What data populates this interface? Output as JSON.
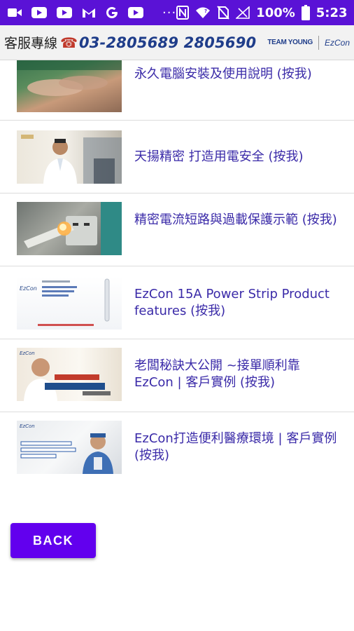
{
  "status_bar": {
    "battery": "100%",
    "time": "5:23",
    "dots": "···",
    "icons": [
      "video-camera-icon",
      "youtube-icon",
      "youtube-icon",
      "gmail-icon",
      "google-icon",
      "youtube-icon",
      "nfc-icon",
      "wifi-icon",
      "no-sim-icon",
      "signal-icon",
      "battery-icon"
    ]
  },
  "header": {
    "hotline_label": "客服專線",
    "phone_icon": "☎",
    "hotline_number": "03-2805689 2805690",
    "logo_teamyoung": "TEAM YOUNG",
    "logo_ezcon": "EzCon"
  },
  "videos": [
    {
      "title": "永久電腦安裝及使用說明 (按我)"
    },
    {
      "title": "天揚精密 打造用電安全 (按我)"
    },
    {
      "title": "精密電流短路與過載保護示範 (按我)"
    },
    {
      "title": "EzCon 15A Power Strip Product features (按我)"
    },
    {
      "title": "老闆秘訣大公開 ~接單順利靠EzCon | 客戶實例 (按我)"
    },
    {
      "title": "EzCon打造便利醫療環境 | 客戶實例 (按我)"
    }
  ],
  "back_button": {
    "label": "BACK"
  },
  "colors": {
    "status_bar": "#5a12d6",
    "accent": "#6200ee",
    "title_text": "#3a2aa8",
    "hotline": "#1f3d8a"
  }
}
